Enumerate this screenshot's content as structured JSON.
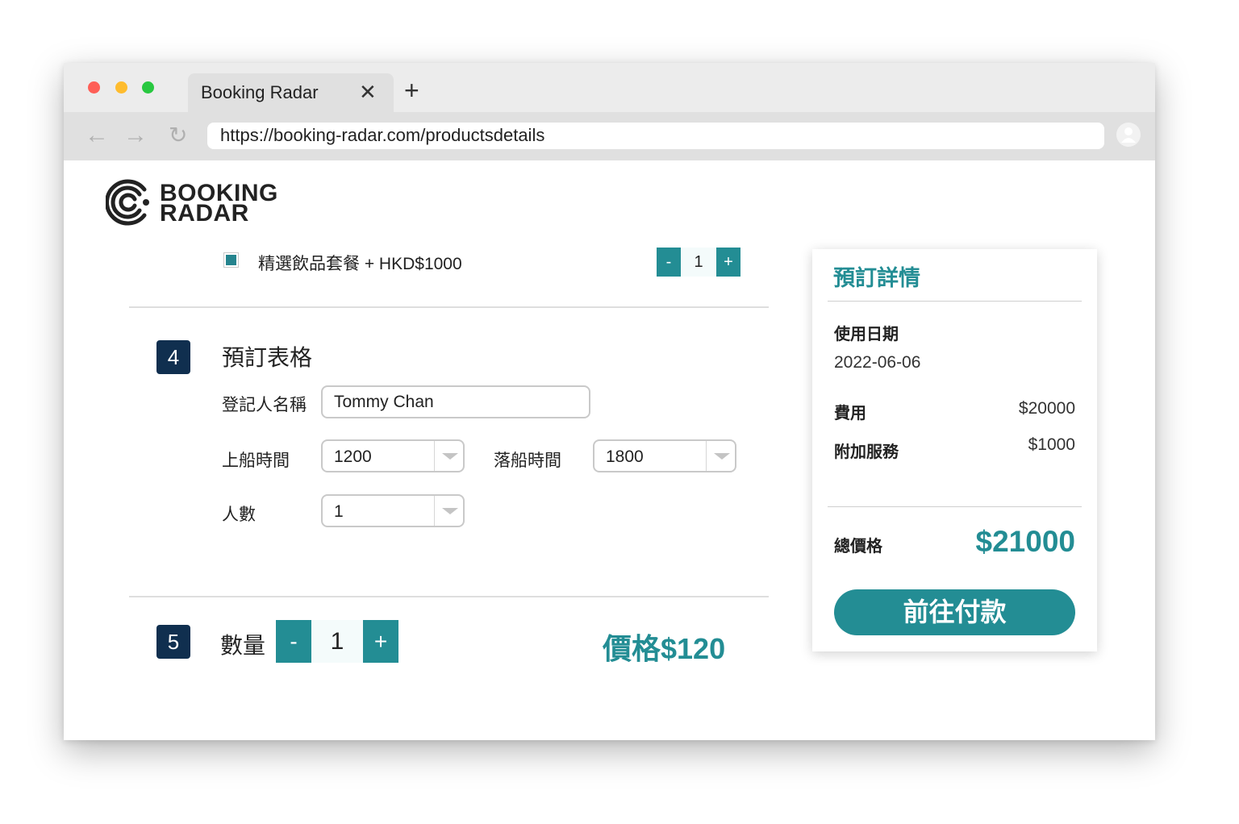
{
  "browser": {
    "tab_title": "Booking Radar",
    "url": "https://booking-radar.com/productsdetails",
    "icons": [
      "close-icon",
      "plus-icon",
      "back-arrow-icon",
      "forward-arrow-icon",
      "reload-icon",
      "profile-icon"
    ]
  },
  "logo": {
    "line1": "BOOKING",
    "line2": "RADAR"
  },
  "addon": {
    "label": "精選飲品套餐 + HKD$1000",
    "checked": true,
    "qty": "1",
    "minus": "-",
    "plus": "+"
  },
  "section4": {
    "number": "4",
    "title": "預訂表格",
    "name_label": "登記人名稱",
    "name_value": "Tommy Chan",
    "board_label": "上船時間",
    "board_value": "1200",
    "alight_label": "落船時間",
    "alight_value": "1800",
    "people_label": "人數",
    "people_value": "1"
  },
  "section5": {
    "number": "5",
    "title": "數量",
    "qty": "1",
    "minus": "-",
    "plus": "+",
    "price": "價格$120"
  },
  "summary": {
    "title": "預訂詳情",
    "date_label": "使用日期",
    "date_value": "2022-06-06",
    "fee_label": "費用",
    "fee_value": "$20000",
    "extra_label": "附加服務",
    "extra_value": "$1000",
    "total_label": "總價格",
    "total_value": "$21000",
    "pay_button": "前往付款"
  },
  "colors": {
    "accent": "#238d94",
    "step_badge": "#102f4f",
    "traffic_red": "#fe5f57",
    "traffic_yellow": "#febc2e",
    "traffic_green": "#28c840"
  }
}
